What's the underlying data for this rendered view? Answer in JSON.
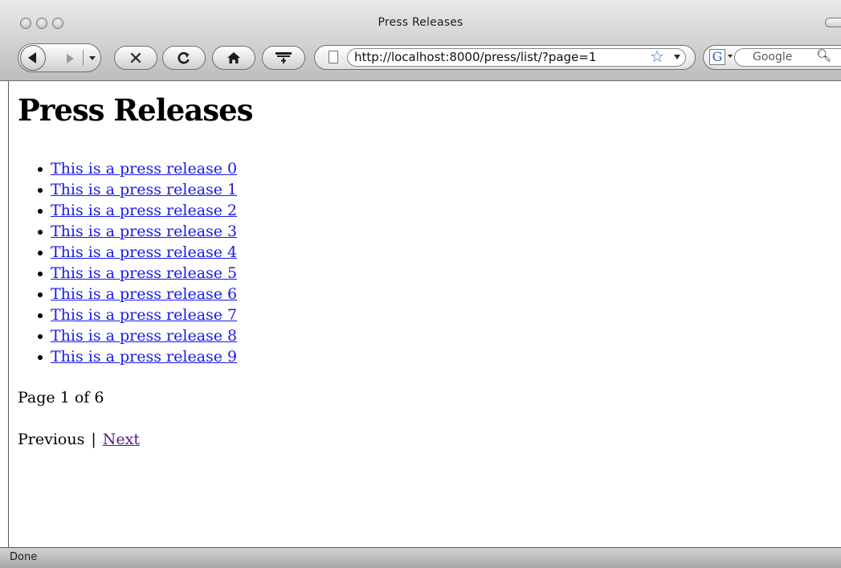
{
  "window": {
    "title": "Press Releases"
  },
  "toolbar": {
    "back_icon": "back-arrow-icon",
    "forward_icon": "forward-arrow-icon",
    "stop_icon": "stop-x-icon",
    "reload_icon": "reload-icon",
    "home_icon": "home-icon",
    "bookmark_icon": "add-bookmark-icon"
  },
  "address_bar": {
    "url": "http://localhost:8000/press/list/?page=1"
  },
  "search_bar": {
    "engine_label": "G",
    "placeholder": "Google"
  },
  "page": {
    "heading": "Press Releases",
    "releases": [
      "This is a press release 0",
      "This is a press release 1",
      "This is a press release 2",
      "This is a press release 3",
      "This is a press release 4",
      "This is a press release 5",
      "This is a press release 6",
      "This is a press release 7",
      "This is a press release 8",
      "This is a press release 9"
    ],
    "pagination_status": "Page 1 of 6",
    "pager": {
      "previous_label": "Previous",
      "separator": "|",
      "next_label": "Next"
    }
  },
  "statusbar": {
    "text": "Done"
  },
  "colors": {
    "link": "#1a1ae6",
    "visited_link": "#551a8b",
    "bookmark_star": "#2a62c9"
  }
}
